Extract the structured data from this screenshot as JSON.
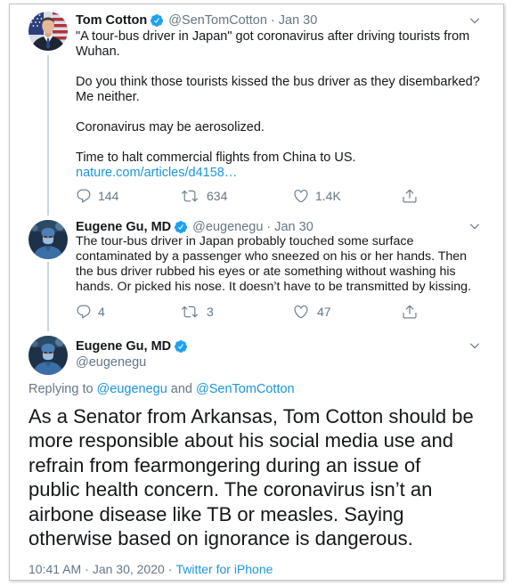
{
  "colors": {
    "text": "#14171a",
    "muted": "#657786",
    "link": "#1b95e0",
    "verified": "#1da1f2",
    "thread": "#ccd6dd"
  },
  "separator": "·",
  "tweets": [
    {
      "name": "Tom Cotton",
      "handle": "@SenTomCotton",
      "date": "Jan 30",
      "verified": true,
      "lines": [
        "\"A tour-bus driver in Japan\" got coronavirus after driving tourists from",
        "Wuhan.",
        "Do you think those tourists kissed the bus driver as they disembarked?",
        "Me neither.",
        "Coronavirus may be aerosolized.",
        "Time to halt commercial flights from China to US."
      ],
      "link": "nature.com/articles/d4158…",
      "actions": {
        "replies": {
          "icon": "reply-icon",
          "count": "144"
        },
        "retweets": {
          "icon": "retweet-icon",
          "count": "634"
        },
        "likes": {
          "icon": "heart-icon",
          "count": "1.4K"
        },
        "share": {
          "icon": "share-icon"
        }
      }
    },
    {
      "name": "Eugene Gu, MD",
      "handle": "@eugenegu",
      "date": "Jan 30",
      "verified": true,
      "lines": [
        "The tour-bus driver in Japan probably touched some surface",
        "contaminated by a passenger who sneezed on his or her hands. Then",
        "the bus driver rubbed his eyes or ate something without washing his",
        "hands. Or picked his nose. It doesn’t have to be transmitted by kissing."
      ],
      "actions": {
        "replies": {
          "icon": "reply-icon",
          "count": "4"
        },
        "retweets": {
          "icon": "retweet-icon",
          "count": "3"
        },
        "likes": {
          "icon": "heart-icon",
          "count": "47"
        },
        "share": {
          "icon": "share-icon"
        }
      }
    }
  ],
  "main_tweet": {
    "name": "Eugene Gu, MD",
    "handle": "@eugenegu",
    "verified": true,
    "replying_to": {
      "label": "Replying to",
      "users": [
        "@eugenegu",
        "@SenTomCotton"
      ],
      "conjunction": "and"
    },
    "lines": [
      "As a Senator from Arkansas, Tom Cotton should be",
      "more responsible about his social media use and",
      "refrain from fearmongering during an issue of",
      "public health concern. The coronavirus isn’t an",
      "airbone disease like TB or measles. Saying",
      "otherwise based on ignorance is dangerous."
    ],
    "footer": {
      "time": "10:41 AM",
      "date": "Jan 30, 2020",
      "source": "Twitter for iPhone"
    }
  }
}
